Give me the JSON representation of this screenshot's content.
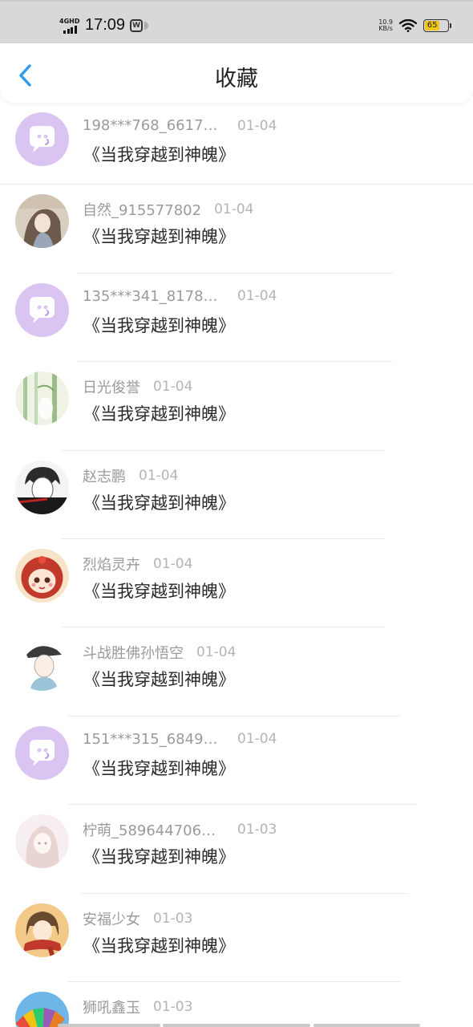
{
  "status_bar": {
    "network": "4GHD",
    "time": "17:09",
    "net_speed_value": "10.9",
    "net_speed_unit": "KB/s",
    "battery": "65",
    "battery_color": "#f0c419"
  },
  "header": {
    "back_icon": "chevron-left-icon",
    "title": "收藏"
  },
  "items": [
    {
      "name": "198***768_6617…",
      "date": "01-04",
      "content": "《当我穿越到神魄》",
      "avatar": "default-chat-avatar"
    },
    {
      "name": "自然_915577802",
      "date": "01-04",
      "content": "《当我穿越到神魄》",
      "avatar": "anime-girl-avatar"
    },
    {
      "name": "135***341_8178…",
      "date": "01-04",
      "content": "《当我穿越到神魄》",
      "avatar": "default-chat-avatar"
    },
    {
      "name": "日光俊誉",
      "date": "01-04",
      "content": "《当我穿越到神魄》",
      "avatar": "bamboo-avatar"
    },
    {
      "name": "赵志鹏",
      "date": "01-04",
      "content": "《当我穿越到神魄》",
      "avatar": "sketch-boy-avatar"
    },
    {
      "name": "烈焰灵卉",
      "date": "01-04",
      "content": "《当我穿越到神魄》",
      "avatar": "cartoon-girl-avatar"
    },
    {
      "name": "斗战胜佛孙悟空",
      "date": "01-04",
      "content": "《当我穿越到神魄》",
      "avatar": "anime-boy-cap-avatar"
    },
    {
      "name": "151***315_6849…",
      "date": "01-04",
      "content": "《当我穿越到神魄》",
      "avatar": "default-chat-avatar"
    },
    {
      "name": "柠萌_589644706…",
      "date": "01-03",
      "content": "《当我穿越到神魄》",
      "avatar": "pastel-girl-avatar"
    },
    {
      "name": "安福少女",
      "date": "01-03",
      "content": "《当我穿越到神魄》",
      "avatar": "scarf-girl-avatar"
    },
    {
      "name": "狮吼鑫玉",
      "date": "01-03",
      "content": "",
      "avatar": "colorful-fan-avatar"
    }
  ],
  "colors": {
    "accent": "#2a9cf0",
    "default_avatar_bg": "#d9c4f2",
    "name_text": "#9a9a9a",
    "date_text": "#b4b4b4",
    "content_text": "#2a2a2a"
  }
}
